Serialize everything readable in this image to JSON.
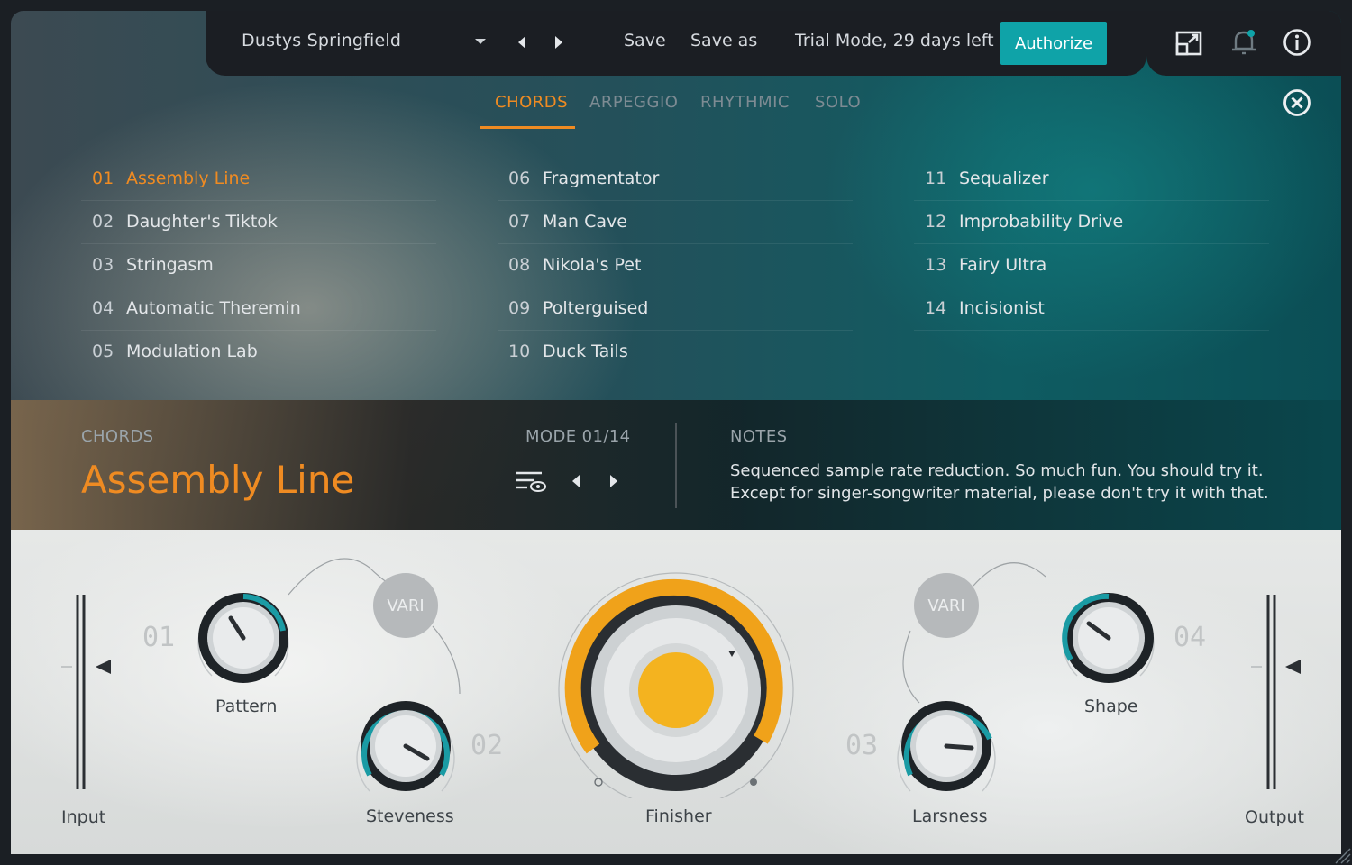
{
  "header": {
    "preset_name": "Dustys Springfield",
    "save_label": "Save",
    "save_as_label": "Save as",
    "trial_text": "Trial Mode, 29 days left",
    "authorize_label": "Authorize"
  },
  "tabs": [
    {
      "label": "CHORDS",
      "active": true
    },
    {
      "label": "ARPEGGIO",
      "active": false
    },
    {
      "label": "RHYTHMIC",
      "active": false
    },
    {
      "label": "SOLO",
      "active": false
    }
  ],
  "modes": [
    {
      "num": "01",
      "name": "Assembly Line",
      "selected": true
    },
    {
      "num": "02",
      "name": "Daughter's Tiktok"
    },
    {
      "num": "03",
      "name": "Stringasm"
    },
    {
      "num": "04",
      "name": "Automatic Theremin"
    },
    {
      "num": "05",
      "name": "Modulation Lab"
    },
    {
      "num": "06",
      "name": "Fragmentator"
    },
    {
      "num": "07",
      "name": "Man Cave"
    },
    {
      "num": "08",
      "name": "Nikola's Pet"
    },
    {
      "num": "09",
      "name": "Polterguised"
    },
    {
      "num": "10",
      "name": "Duck Tails"
    },
    {
      "num": "11",
      "name": "Sequalizer"
    },
    {
      "num": "12",
      "name": "Improbability Drive"
    },
    {
      "num": "13",
      "name": "Fairy Ultra"
    },
    {
      "num": "14",
      "name": "Incisionist"
    }
  ],
  "info": {
    "category": "CHORDS",
    "mode_name": "Assembly Line",
    "mode_counter": "MODE 01/14",
    "notes_label": "NOTES",
    "notes_line1": "Sequenced sample rate reduction. So much fun. You should try it.",
    "notes_line2": "Except for singer-songwriter material, please don't try it with that."
  },
  "controls": {
    "input_label": "Input",
    "output_label": "Output",
    "pattern_label": "Pattern",
    "steveness_label": "Steveness",
    "finisher_label": "Finisher",
    "larsness_label": "Larsness",
    "shape_label": "Shape",
    "vari_label": "VARI",
    "num_01": "01",
    "num_02": "02",
    "num_03": "03",
    "num_04": "04"
  },
  "colors": {
    "accent": "#ef8b22",
    "authorize": "#0fa3a8",
    "knob_ring": "#1a9ba4"
  }
}
